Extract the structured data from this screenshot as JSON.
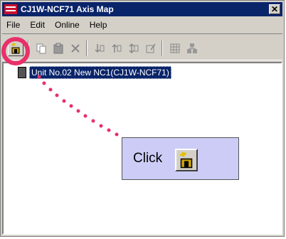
{
  "window": {
    "title": "CJ1W-NCF71 Axis Map",
    "close_glyph": "✕"
  },
  "menu": [
    {
      "label": "File"
    },
    {
      "label": "Edit"
    },
    {
      "label": "Online"
    },
    {
      "label": "Help"
    }
  ],
  "tree": {
    "unit_label": "Unit No.02 New NC1(CJ1W-NCF71)"
  },
  "callout": {
    "text": "Click"
  },
  "colors": {
    "title_bg": "#0a246a",
    "highlight": "#e8306a",
    "callout_bg": "#ccccf6",
    "face": "#d4d0c8"
  }
}
